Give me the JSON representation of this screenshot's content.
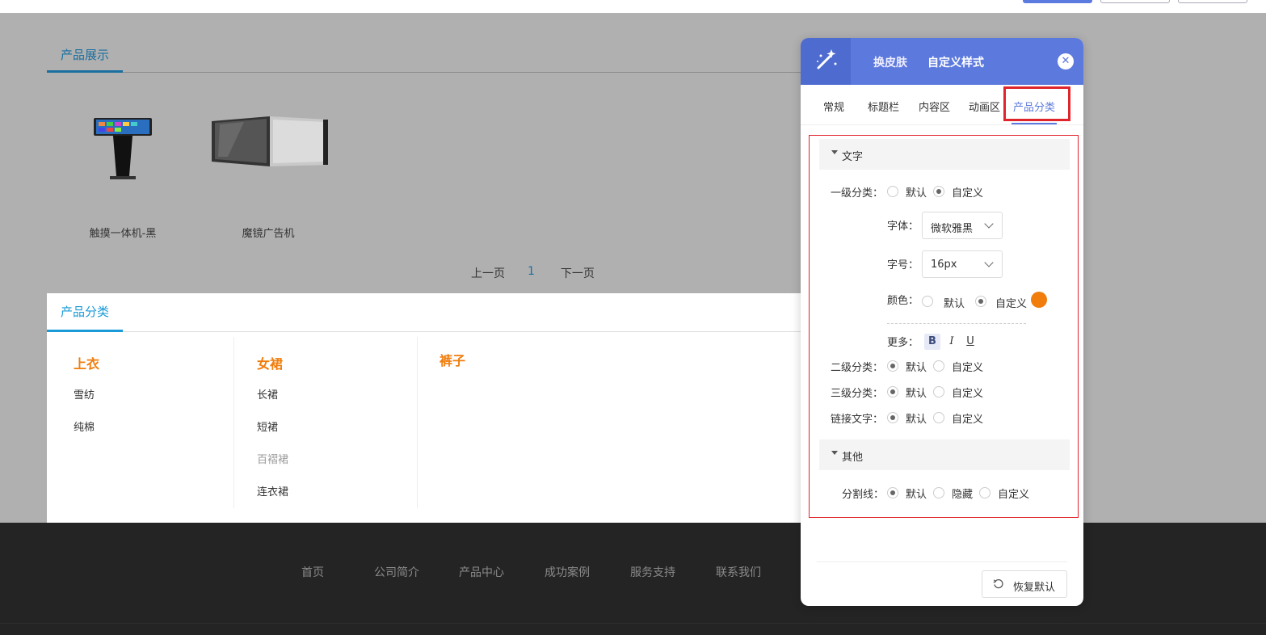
{
  "product_display": {
    "tab_label": "产品展示",
    "products": [
      {
        "name": "触摸一体机-黑",
        "image": "kiosk-image"
      },
      {
        "name": "魔镜广告机",
        "image": "mirror-display-image"
      }
    ],
    "pager": {
      "prev": "上一页",
      "current": "1",
      "next": "下一页"
    }
  },
  "categories": {
    "tab_label": "产品分类",
    "groups": [
      {
        "title": "上衣",
        "items": [
          "雪纺",
          "纯棉"
        ]
      },
      {
        "title": "女裙",
        "items": [
          "长裙",
          "短裙",
          "百褶裙",
          "连衣裙"
        ]
      },
      {
        "title": "裤子",
        "items": []
      }
    ]
  },
  "footer": {
    "nav": [
      "首页",
      "公司简介",
      "产品中心",
      "成功案例",
      "服务支持",
      "联系我们"
    ]
  },
  "panel": {
    "header_tabs": [
      "换皮肤",
      "自定义样式"
    ],
    "close_icon": "close-icon",
    "tabs": [
      "常规",
      "标题栏",
      "内容区",
      "动画区",
      "产品分类"
    ],
    "active_tab": "产品分类",
    "text_section": {
      "title": "文字",
      "level1_label": "一级分类：",
      "level1_options": [
        "默认",
        "自定义"
      ],
      "level1_selected": "自定义",
      "font_label": "字体：",
      "font_value": "微软雅黑",
      "size_label": "字号：",
      "size_value": "16px",
      "color_label": "颜色：",
      "color_options": [
        "默认",
        "自定义"
      ],
      "color_selected": "自定义",
      "color_value": "#f07d0c",
      "more_label": "更多：",
      "format_buttons": [
        "B",
        "I",
        "U"
      ],
      "level2_label": "二级分类：",
      "level2_options": [
        "默认",
        "自定义"
      ],
      "level2_selected": "默认",
      "level3_label": "三级分类：",
      "level3_options": [
        "默认",
        "自定义"
      ],
      "level3_selected": "默认",
      "link_label": "链接文字：",
      "link_options": [
        "默认",
        "自定义"
      ],
      "link_selected": "默认"
    },
    "other_section": {
      "title": "其他",
      "divider_label": "分割线：",
      "divider_options": [
        "默认",
        "隐藏",
        "自定义"
      ],
      "divider_selected": "默认"
    },
    "reset_label": "恢复默认"
  },
  "colors": {
    "accent": "#5c79dd",
    "category_title": "#f07d0c",
    "highlight_border": "#e0242b"
  }
}
